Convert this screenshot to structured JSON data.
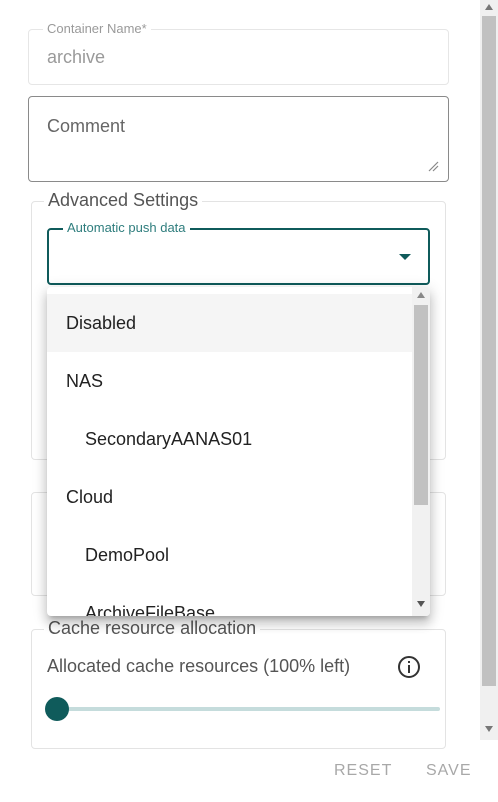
{
  "form": {
    "container_name": {
      "label": "Container Name*",
      "value": "archive"
    },
    "comment": {
      "placeholder": "Comment"
    }
  },
  "advanced_settings": {
    "title": "Advanced Settings",
    "push_data": {
      "label": "Automatic push data",
      "value": ""
    }
  },
  "dropdown": {
    "options": [
      {
        "label": "Disabled",
        "kind": "option",
        "selected": true
      },
      {
        "label": "NAS",
        "kind": "group"
      },
      {
        "label": "SecondaryAANAS01",
        "kind": "child"
      },
      {
        "label": "Cloud",
        "kind": "group"
      },
      {
        "label": "DemoPool",
        "kind": "child"
      },
      {
        "label": "ArchiveFileBase",
        "kind": "child"
      }
    ]
  },
  "cache": {
    "title": "Cache resource allocation",
    "label": "Allocated cache resources (100% left)",
    "icon": "info-icon",
    "slider_value_percent": 0
  },
  "footer": {
    "reset_label": "RESET",
    "save_label": "SAVE"
  },
  "colors": {
    "accent": "#0f5b5b",
    "accent_light": "#c5dcdc"
  }
}
